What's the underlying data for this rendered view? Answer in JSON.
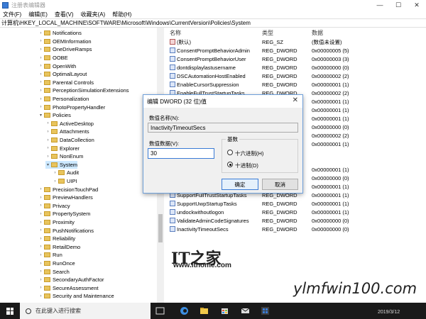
{
  "window": {
    "title": "注册表编辑器"
  },
  "menu": [
    "文件(F)",
    "编辑(E)",
    "查看(V)",
    "收藏夹(A)",
    "帮助(H)"
  ],
  "address": "计算机\\HKEY_LOCAL_MACHINE\\SOFTWARE\\Microsoft\\Windows\\CurrentVersion\\Policies\\System",
  "tree": [
    {
      "label": "Notifications",
      "level": 0,
      "expanded": false
    },
    {
      "label": "OEMInformation",
      "level": 0,
      "expanded": false
    },
    {
      "label": "OneDriveRamps",
      "level": 0,
      "expanded": false
    },
    {
      "label": "OOBE",
      "level": 0,
      "expanded": false
    },
    {
      "label": "OpenWith",
      "level": 0,
      "expanded": false
    },
    {
      "label": "OptimalLayout",
      "level": 0,
      "expanded": false
    },
    {
      "label": "Parental Controls",
      "level": 0,
      "expanded": false
    },
    {
      "label": "PerceptionSimulationExtensions",
      "level": 0,
      "expanded": false
    },
    {
      "label": "Personalization",
      "level": 0,
      "expanded": false
    },
    {
      "label": "PhotoPropertyHandler",
      "level": 0,
      "expanded": false
    },
    {
      "label": "Policies",
      "level": 0,
      "expanded": true
    },
    {
      "label": "ActiveDesktop",
      "level": 1,
      "expanded": false
    },
    {
      "label": "Attachments",
      "level": 1,
      "expanded": false
    },
    {
      "label": "DataCollection",
      "level": 1,
      "expanded": false
    },
    {
      "label": "Explorer",
      "level": 1,
      "expanded": false
    },
    {
      "label": "NonEnum",
      "level": 1,
      "expanded": false
    },
    {
      "label": "System",
      "level": 1,
      "expanded": true,
      "selected": true
    },
    {
      "label": "Audit",
      "level": 2,
      "expanded": false
    },
    {
      "label": "UIPI",
      "level": 2,
      "expanded": false
    },
    {
      "label": "PrecisionTouchPad",
      "level": 0,
      "expanded": false
    },
    {
      "label": "PreviewHandlers",
      "level": 0,
      "expanded": false
    },
    {
      "label": "Privacy",
      "level": 0,
      "expanded": false
    },
    {
      "label": "PropertySystem",
      "level": 0,
      "expanded": false
    },
    {
      "label": "Proximity",
      "level": 0,
      "expanded": false
    },
    {
      "label": "PushNotifications",
      "level": 0,
      "expanded": false
    },
    {
      "label": "Reliability",
      "level": 0,
      "expanded": false
    },
    {
      "label": "RetailDemo",
      "level": 0,
      "expanded": false
    },
    {
      "label": "Run",
      "level": 0,
      "expanded": false
    },
    {
      "label": "RunOnce",
      "level": 0,
      "expanded": false
    },
    {
      "label": "Search",
      "level": 0,
      "expanded": false
    },
    {
      "label": "SecondaryAuthFactor",
      "level": 0,
      "expanded": false
    },
    {
      "label": "SecureAssessment",
      "level": 0,
      "expanded": false
    },
    {
      "label": "Security and Maintenance",
      "level": 0,
      "expanded": false
    }
  ],
  "list": {
    "headers": {
      "name": "名称",
      "type": "类型",
      "data": "数据"
    },
    "rows": [
      {
        "name": "(默认)",
        "type": "REG_SZ",
        "data": "(数值未设置)",
        "kind": "sz"
      },
      {
        "name": "ConsentPromptBehaviorAdmin",
        "type": "REG_DWORD",
        "data": "0x00000005 (5)",
        "kind": "dword"
      },
      {
        "name": "ConsentPromptBehaviorUser",
        "type": "REG_DWORD",
        "data": "0x00000003 (3)",
        "kind": "dword"
      },
      {
        "name": "dontdisplaylastusername",
        "type": "REG_DWORD",
        "data": "0x00000000 (0)",
        "kind": "dword"
      },
      {
        "name": "DSCAutomationHostEnabled",
        "type": "REG_DWORD",
        "data": "0x00000002 (2)",
        "kind": "dword"
      },
      {
        "name": "EnableCursorSuppression",
        "type": "REG_DWORD",
        "data": "0x00000001 (1)",
        "kind": "dword"
      },
      {
        "name": "EnableFullTrustStartupTasks",
        "type": "REG_DWORD",
        "data": "0x00000002 (2)",
        "kind": "dword"
      },
      {
        "name": "",
        "type": "",
        "data": "0x00000001 (1)",
        "kind": "dword"
      },
      {
        "name": "",
        "type": "",
        "data": "0x00000001 (1)",
        "kind": "dword"
      },
      {
        "name": "",
        "type": "",
        "data": "0x00000001 (1)",
        "kind": "dword"
      },
      {
        "name": "",
        "type": "",
        "data": "0x00000000 (0)",
        "kind": "dword"
      },
      {
        "name": "",
        "type": "",
        "data": "0x00000002 (2)",
        "kind": "dword"
      },
      {
        "name": "",
        "type": "",
        "data": "0x00000001 (1)",
        "kind": "dword"
      },
      {
        "name": "",
        "type": "",
        "data": "",
        "kind": "none"
      },
      {
        "name": "",
        "type": "",
        "data": "",
        "kind": "none"
      },
      {
        "name": "",
        "type": "",
        "data": "0x00000001 (1)",
        "kind": "dword"
      },
      {
        "name": "",
        "type": "",
        "data": "0x00000000 (0)",
        "kind": "dword"
      },
      {
        "name": "",
        "type": "",
        "data": "0x00000001 (1)",
        "kind": "dword"
      },
      {
        "name": "SupportFullTrustStartupTasks",
        "type": "REG_DWORD",
        "data": "0x00000001 (1)",
        "kind": "dword"
      },
      {
        "name": "SupportUwpStartupTasks",
        "type": "REG_DWORD",
        "data": "0x00000001 (1)",
        "kind": "dword"
      },
      {
        "name": "undockwithoutlogon",
        "type": "REG_DWORD",
        "data": "0x00000001 (1)",
        "kind": "dword"
      },
      {
        "name": "ValidateAdminCodeSignatures",
        "type": "REG_DWORD",
        "data": "0x00000000 (0)",
        "kind": "dword"
      },
      {
        "name": "InactivityTimeoutSecs",
        "type": "REG_DWORD",
        "data": "0x00000000 (0)",
        "kind": "dword"
      }
    ]
  },
  "dialog": {
    "title": "编辑 DWORD (32 位)值",
    "name_label": "数值名称(N):",
    "name_value": "InactivityTimeoutSecs",
    "data_label": "数值数据(V):",
    "data_value": "30",
    "base_label": "基数",
    "hex_label": "十六进制(H)",
    "dec_label": "十进制(D)",
    "ok_label": "确定",
    "cancel_label": "取消"
  },
  "watermark": {
    "logo": "IT之家",
    "url": "www.ithome.com",
    "brand": "ylmfwin100.com"
  },
  "taskbar": {
    "search_placeholder": "在此键入进行搜索",
    "date": "2019/3/12"
  }
}
